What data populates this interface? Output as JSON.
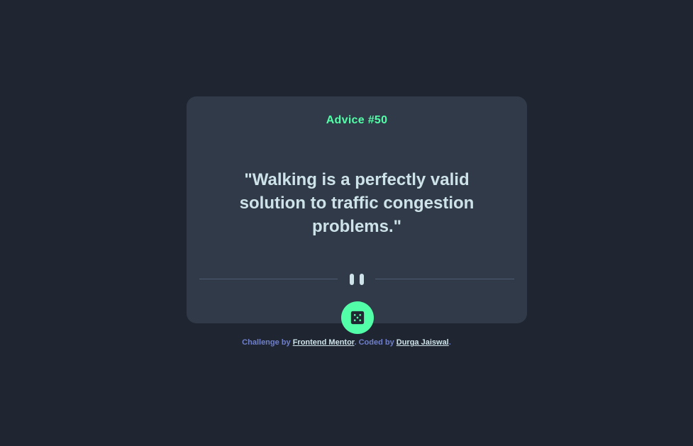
{
  "card": {
    "advice_label": "Advice #50",
    "advice_text": "\"Walking is a perfectly valid solution to traffic congestion problems.\""
  },
  "divider": {
    "icon": "pause-icon"
  },
  "button": {
    "icon": "dice-icon"
  },
  "footer": {
    "challenge_prefix": "Challenge by ",
    "challenge_link": "Frontend Mentor",
    "coded_prefix": ". Coded by ",
    "author_link": "Durga Jaiswal",
    "suffix": "."
  },
  "colors": {
    "background": "#1f2632",
    "card": "#313a48",
    "accent": "#52ffa8",
    "text": "#cee3e9",
    "footer_text": "#6f7fc9"
  }
}
